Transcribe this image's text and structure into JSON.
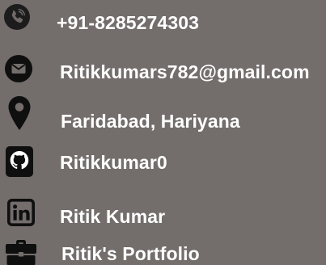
{
  "contacts": [
    {
      "type": "phone",
      "icon": "phone-icon",
      "text": "+91-8285274303"
    },
    {
      "type": "email",
      "icon": "envelope-icon",
      "text": "Ritikkumars782@gmail.com"
    },
    {
      "type": "location",
      "icon": "map-pin-icon",
      "text": "Faridabad, Hariyana"
    },
    {
      "type": "github",
      "icon": "github-icon",
      "text": "Ritikkumar0"
    },
    {
      "type": "linkedin",
      "icon": "linkedin-icon",
      "text": "Ritik Kumar"
    },
    {
      "type": "portfolio",
      "icon": "briefcase-icon",
      "text": "Ritik's Portfolio"
    }
  ],
  "colors": {
    "background": "#736d6b",
    "icon": "#111111",
    "text": "#ffffff"
  }
}
